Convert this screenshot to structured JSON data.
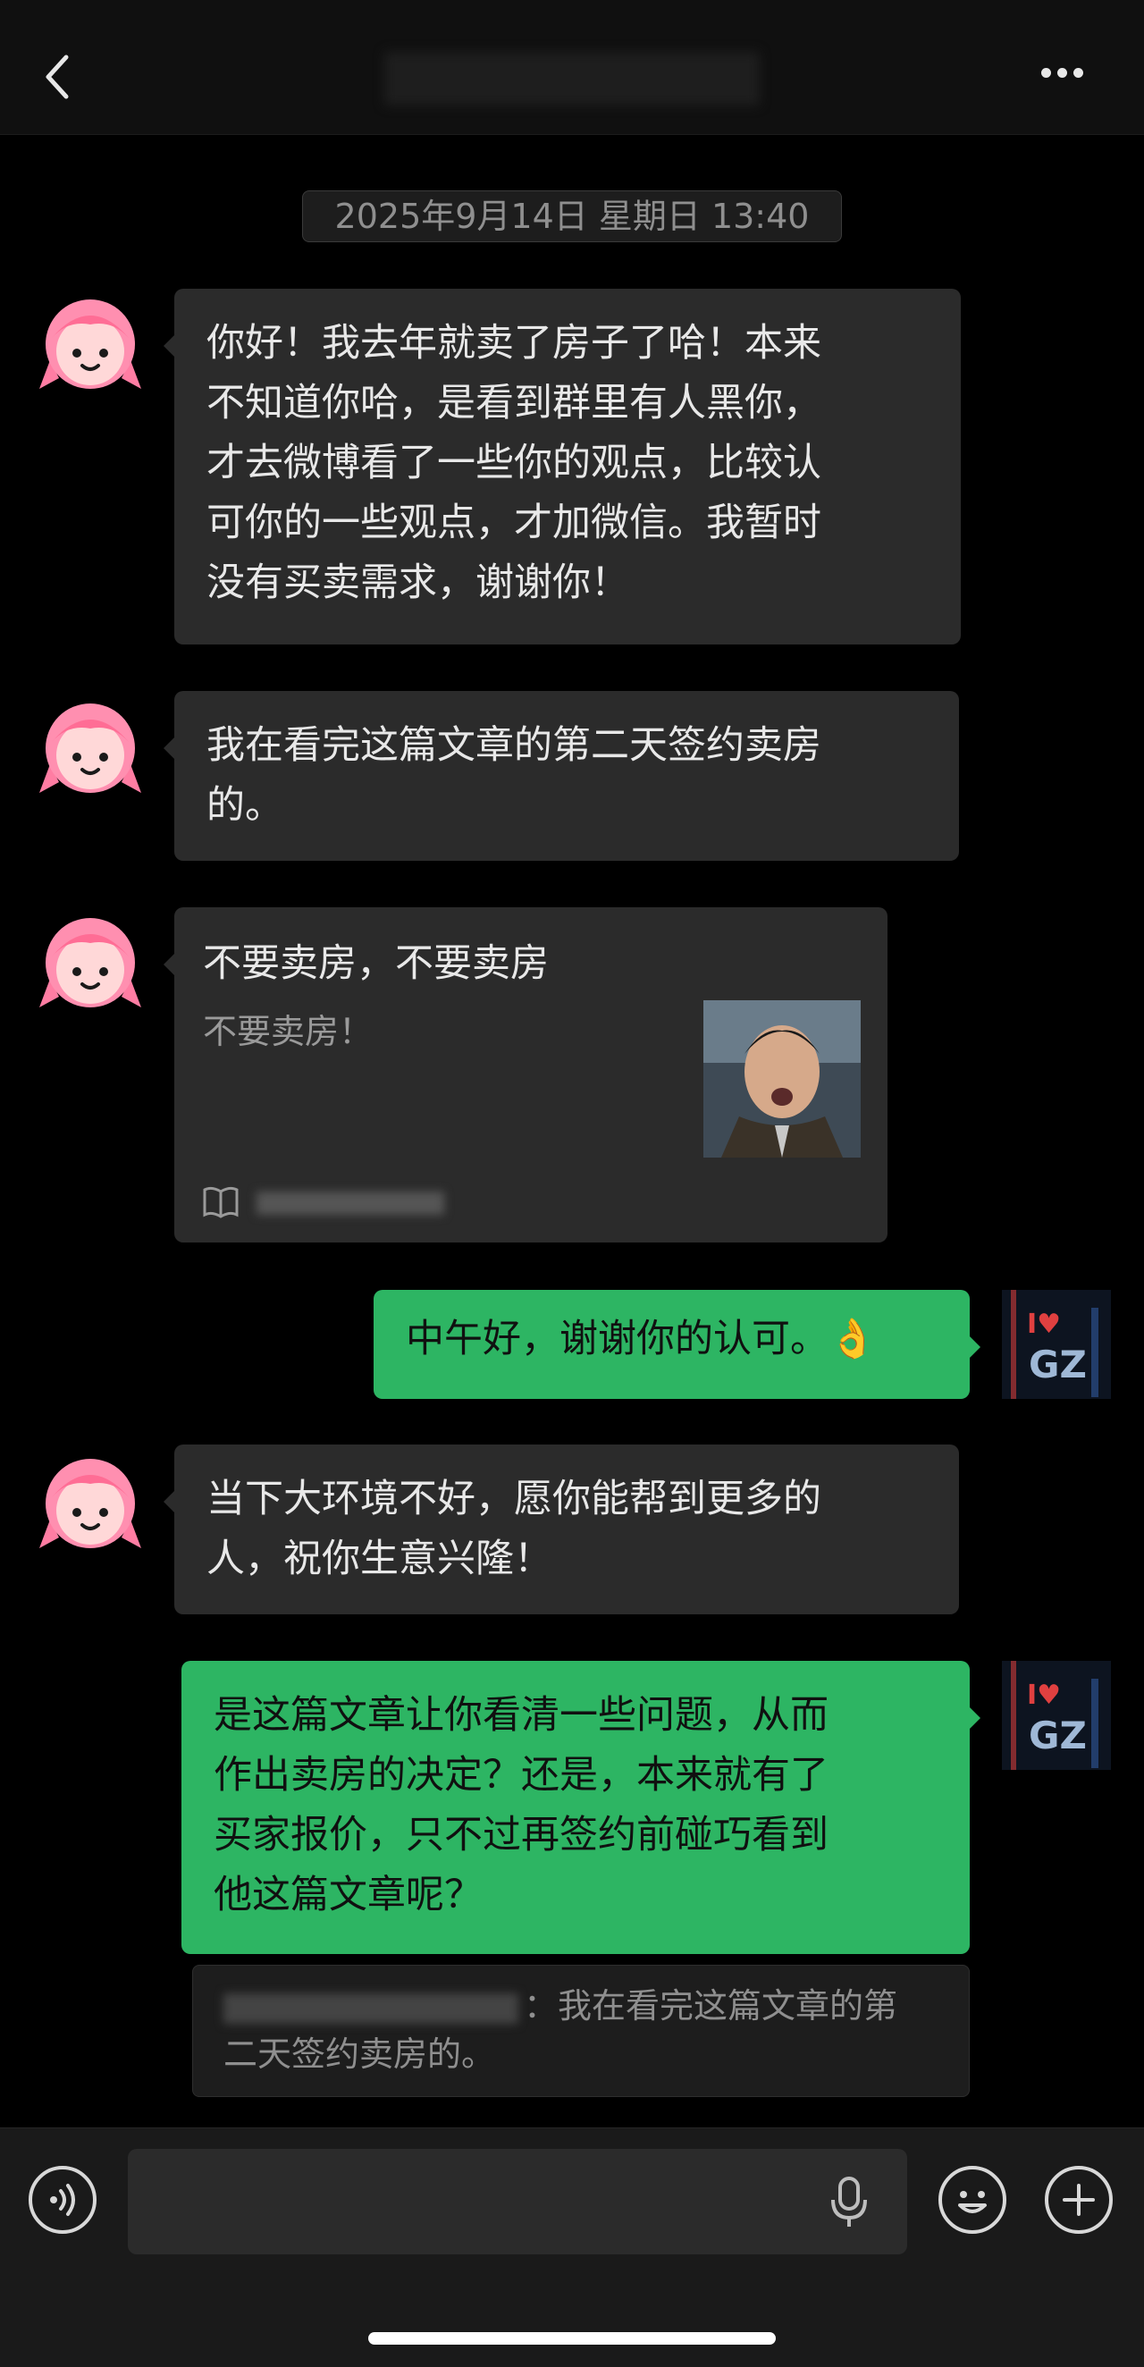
{
  "header": {
    "title": "",
    "back_icon": "chevron-left-icon",
    "more_icon": "more-dots-icon"
  },
  "timestamp": "2025年9月14日 星期日 13:40",
  "messages": [
    {
      "sender": "other",
      "text_lines": [
        "你好！我去年就卖了房子了哈！本来",
        "不知道你哈，是看到群里有人黑你，",
        "才去微博看了一些你的观点，比较认",
        "可你的一些观点，才加微信。我暂时",
        "没有买卖需求，谢谢你！"
      ]
    },
    {
      "sender": "other",
      "text_lines": [
        "我在看完这篇文章的第二天签约卖房",
        "的。"
      ]
    },
    {
      "sender": "other",
      "type": "article_card",
      "title": "不要卖房，不要卖房",
      "description": "不要卖房！",
      "source_icon": "book-icon"
    },
    {
      "sender": "me",
      "text_lines": [
        "中午好，谢谢你的认可。👌"
      ]
    },
    {
      "sender": "other",
      "text_lines": [
        "当下大环境不好，愿你能帮到更多的",
        "人，祝你生意兴隆！"
      ]
    },
    {
      "sender": "me",
      "text_lines": [
        "是这篇文章让你看清一些问题，从而",
        "作出卖房的决定？还是，本来就有了",
        "买家报价，只不过再签约前碰巧看到",
        "他这篇文章呢？"
      ]
    }
  ],
  "quote": {
    "prefix": "：",
    "text_lines": [
      "我在看完这篇文章的第",
      "二天签约卖房的。"
    ]
  },
  "input_bar": {
    "voice_icon": "voice-icon",
    "mic_icon": "microphone-icon",
    "emoji_icon": "emoji-icon",
    "plus_icon": "plus-icon"
  },
  "colors": {
    "my_bubble": "#2db563",
    "other_bubble": "#2b2b2b",
    "background": "#000000"
  }
}
